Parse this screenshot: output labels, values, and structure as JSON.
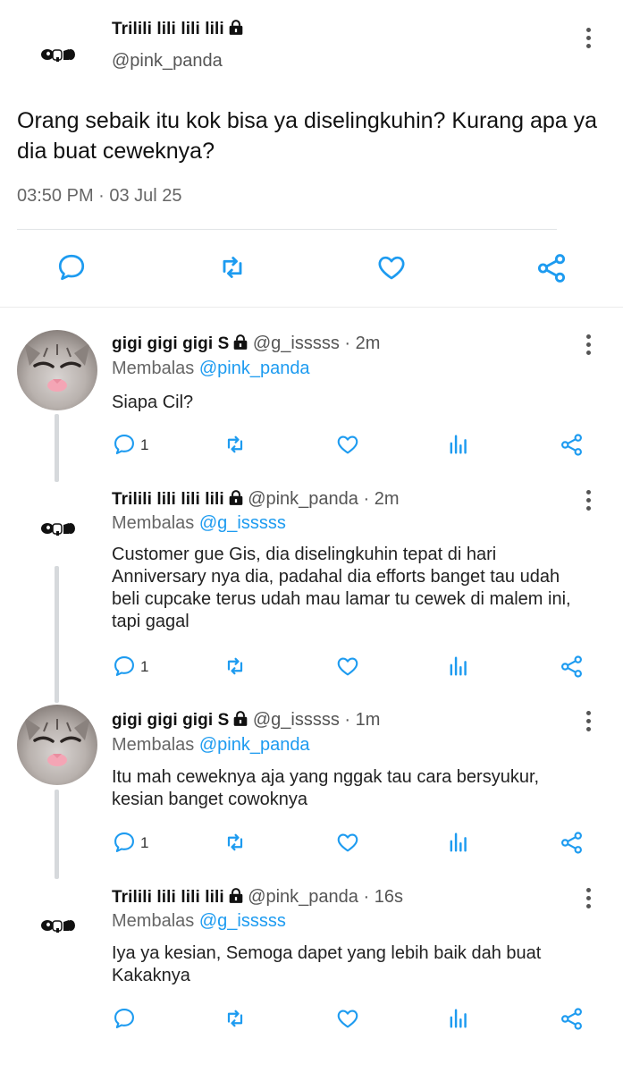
{
  "main_post": {
    "author_name": "Trilili lili lili lili",
    "handle": "@pink_panda",
    "text": "Orang sebaik itu kok bisa ya diselingkuhin? Kurang apa ya dia buat ceweknya?",
    "timestamp": "03:50 PM · 03 Jul 25",
    "actions": [
      "reply-icon",
      "retweet-icon",
      "like-icon",
      "share-icon"
    ]
  },
  "replies": [
    {
      "author_name": "gigi gigi gigi S",
      "handle_time": "@g_isssss · 2m",
      "reply_prefix": "Membalas",
      "reply_to": "@pink_panda",
      "text": "Siapa Cil?",
      "reply_count": "1"
    },
    {
      "author_name": "Trilili lili lili lili",
      "handle_time": "@pink_panda · 2m",
      "reply_prefix": "Membalas",
      "reply_to": "@g_isssss",
      "text_lines": [
        "Customer gue Gis, dia diselingkuhin tepat di hari",
        "Anniversary nya dia, padahal dia efforts banget tau udah",
        "beli cupcake terus udah mau lamar tu cewek di malem ini,",
        "tapi gagal"
      ],
      "reply_count": "1"
    },
    {
      "author_name": "gigi gigi gigi S",
      "handle_time": "@g_isssss · 1m",
      "reply_prefix": "Membalas",
      "reply_to": "@pink_panda",
      "text_lines": [
        "Itu mah ceweknya aja yang nggak tau cara bersyukur,",
        "kesian banget cowoknya"
      ],
      "reply_count": "1"
    },
    {
      "author_name": "Trilili lili lili lili",
      "handle_time": "@pink_panda · 16s",
      "reply_prefix": "Membalas",
      "reply_to": "@g_isssss",
      "text_lines": [
        "Iya ya kesian, Semoga dapet yang lebih baik dah buat",
        "Kakaknya"
      ],
      "reply_count": ""
    }
  ],
  "colors": {
    "link": "#1d9bf0",
    "icon": "#1d9bf0",
    "thread_line": "#d6d9dc"
  }
}
